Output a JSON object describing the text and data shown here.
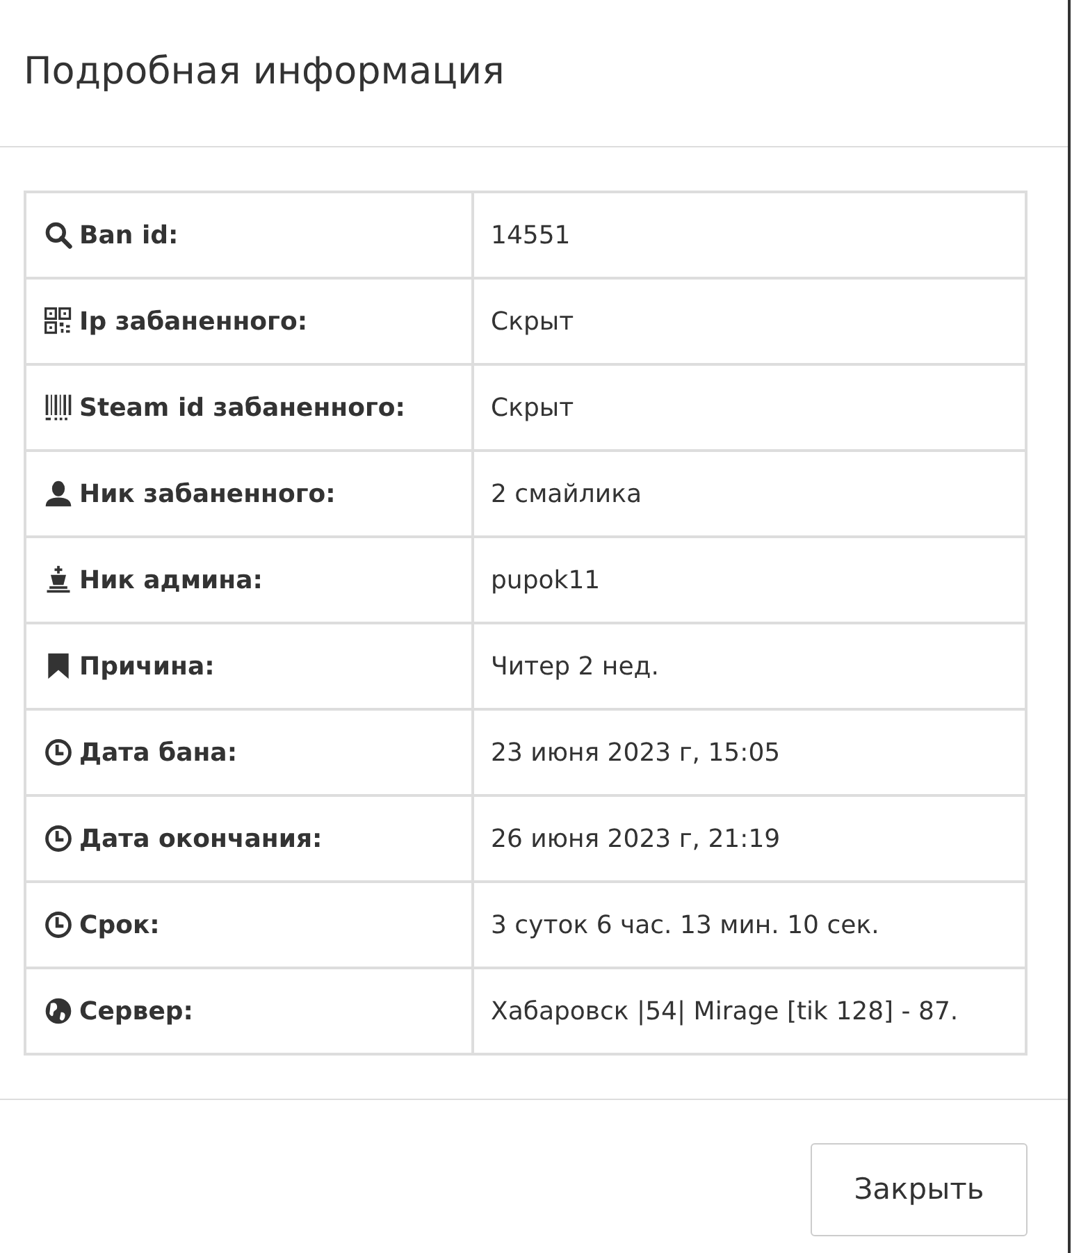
{
  "modal": {
    "title": "Подробная информация",
    "rows": [
      {
        "label": "Ban id:",
        "value": "14551"
      },
      {
        "label": "Ip забаненного:",
        "value": "Скрыт"
      },
      {
        "label": "Steam id забаненного:",
        "value": "Скрыт"
      },
      {
        "label": "Ник забаненного:",
        "value": "2 смайлика"
      },
      {
        "label": "Ник админа:",
        "value": "pupok11"
      },
      {
        "label": "Причина:",
        "value": "Читер 2 нед."
      },
      {
        "label": "Дата бана:",
        "value": "23 июня 2023 г, 15:05"
      },
      {
        "label": "Дата окончания:",
        "value": "26 июня 2023 г, 21:19"
      },
      {
        "label": "Срок:",
        "value": "3 суток 6 час. 13 мин. 10 сек."
      },
      {
        "label": "Сервер:",
        "value": "Хабаровск |54| Mirage [tik 128] - 87."
      }
    ],
    "buttons": [
      "Закрыть"
    ]
  }
}
